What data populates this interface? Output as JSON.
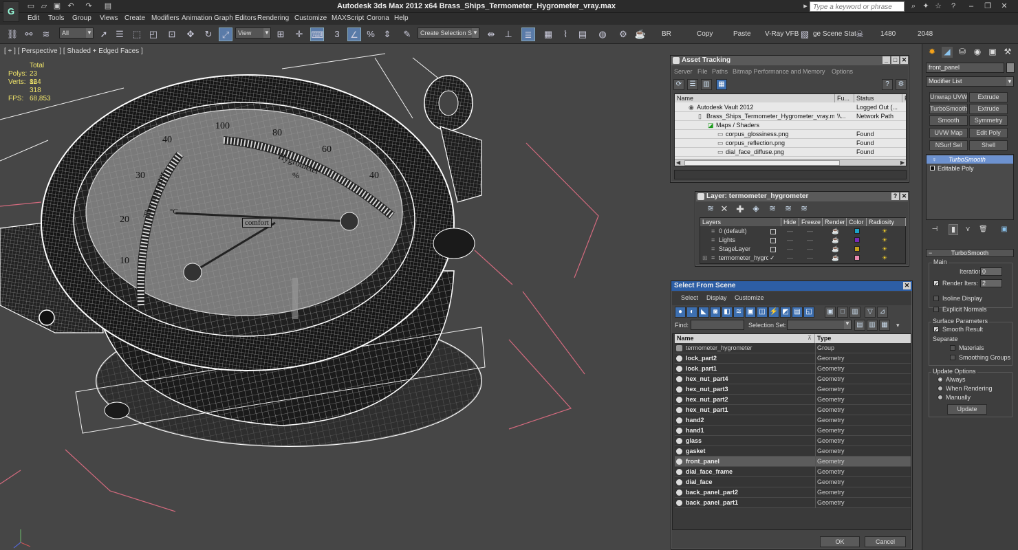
{
  "app": {
    "title": "Autodesk 3ds Max  2012 x64      Brass_Ships_Termometer_Hygrometer_vray.max",
    "search_placeholder": "Type a keyword or phrase"
  },
  "menu": [
    "Edit",
    "Tools",
    "Group",
    "Views",
    "Create",
    "Modifiers",
    "Animation",
    "Graph Editors",
    "Rendering",
    "Customize",
    "MAXScript",
    "Corona",
    "Help"
  ],
  "toolbar": {
    "selection_filter": "All",
    "ref_coord": "View",
    "snap_value": "3",
    "named_selection": "Create Selection Se",
    "br": "BR",
    "copy": "Copy",
    "paste": "Paste",
    "vray_vfb": "V-Ray VFB",
    "stage": "ge Scene Stat",
    "width": "1480",
    "height": "2048"
  },
  "viewport": {
    "label": "[ + ] [ Perspective ] [ Shaded + Edged Faces ]",
    "stats": {
      "total": "Total",
      "polys_label": "Polys:",
      "polys": "23 864",
      "verts_label": "Verts:",
      "verts": "12 318",
      "fps_label": "FPS:",
      "fps": "68,853"
    },
    "dial_labels": [
      "100",
      "80",
      "60",
      "40",
      "40",
      "30",
      "20",
      "10",
      "Hygrometer",
      "%",
      "Thermometer",
      "°C",
      "comfort"
    ]
  },
  "asset_tracking": {
    "title": "Asset Tracking",
    "menu": [
      "Server",
      "File",
      "Paths",
      "Bitmap Performance and Memory",
      "Options"
    ],
    "columns": [
      "Name",
      "Fu...",
      "Status",
      "P"
    ],
    "rows": [
      {
        "name": "Autodesk Vault 2012",
        "full": "",
        "status": "Logged Out (..."
      },
      {
        "name": "Brass_Ships_Termometer_Hygrometer_vray.max",
        "full": "\\\\...",
        "status": "Network Path"
      },
      {
        "name": "Maps / Shaders",
        "full": "",
        "status": ""
      },
      {
        "name": "corpus_glossiness.png",
        "full": "",
        "status": "Found"
      },
      {
        "name": "corpus_reflection.png",
        "full": "",
        "status": "Found"
      },
      {
        "name": "dial_face_diffuse.png",
        "full": "",
        "status": "Found"
      }
    ]
  },
  "layer_dialog": {
    "title": "Layer: termometer_hygrometer",
    "columns": [
      "Layers",
      "Hide",
      "Freeze",
      "Render",
      "Color",
      "Radiosity"
    ],
    "rows": [
      {
        "name": "0 (default)",
        "color": "#1aa3c9"
      },
      {
        "name": "Lights",
        "color": "#7a2ab8"
      },
      {
        "name": "StageLayer",
        "color": "#c6a11a"
      },
      {
        "name": "termometer_hygrom",
        "color": "#e88ab0"
      }
    ]
  },
  "select_from_scene": {
    "title": "Select From Scene",
    "menu": [
      "Select",
      "Display",
      "Customize"
    ],
    "find_label": "Find:",
    "selection_set_label": "Selection Set:",
    "columns": [
      "Name",
      "Type"
    ],
    "rows": [
      {
        "name": "termometer_hygrometer",
        "type": "Group"
      },
      {
        "name": "lock_part2",
        "type": "Geometry"
      },
      {
        "name": "lock_part1",
        "type": "Geometry"
      },
      {
        "name": "hex_nut_part4",
        "type": "Geometry"
      },
      {
        "name": "hex_nut_part3",
        "type": "Geometry"
      },
      {
        "name": "hex_nut_part2",
        "type": "Geometry"
      },
      {
        "name": "hex_nut_part1",
        "type": "Geometry"
      },
      {
        "name": "hand2",
        "type": "Geometry"
      },
      {
        "name": "hand1",
        "type": "Geometry"
      },
      {
        "name": "glass",
        "type": "Geometry"
      },
      {
        "name": "gasket",
        "type": "Geometry"
      },
      {
        "name": "front_panel",
        "type": "Geometry"
      },
      {
        "name": "dial_face_frame",
        "type": "Geometry"
      },
      {
        "name": "dial_face",
        "type": "Geometry"
      },
      {
        "name": "back_panel_part2",
        "type": "Geometry"
      },
      {
        "name": "back_panel_part1",
        "type": "Geometry"
      }
    ],
    "selected": "front_panel",
    "ok": "OK",
    "cancel": "Cancel"
  },
  "command_panel": {
    "object_name": "front_panel",
    "modifier_list": "Modifier List",
    "modifier_buttons": [
      "Unwrap UVW",
      "Extrude",
      "TurboSmooth",
      "Extrude",
      "Smooth",
      "Symmetry",
      "UVW Map",
      "Edit Poly",
      "NSurf Sel",
      "Shell"
    ],
    "stack": [
      "TurboSmooth",
      "Editable Poly"
    ],
    "rollout": "TurboSmooth",
    "main": "Main",
    "iterations_label": "Iterations:",
    "iterations": "0",
    "render_iters_label": "Render Iters:",
    "render_iters": "2",
    "isoline": "Isoline Display",
    "explicit_normals": "Explicit Normals",
    "surface_params": "Surface Parameters",
    "smooth_result": "Smooth Result",
    "separate": "Separate",
    "materials": "Materials",
    "smoothing_groups": "Smoothing Groups",
    "update_options": "Update Options",
    "always": "Always",
    "when_rendering": "When Rendering",
    "manually": "Manually",
    "update": "Update"
  }
}
